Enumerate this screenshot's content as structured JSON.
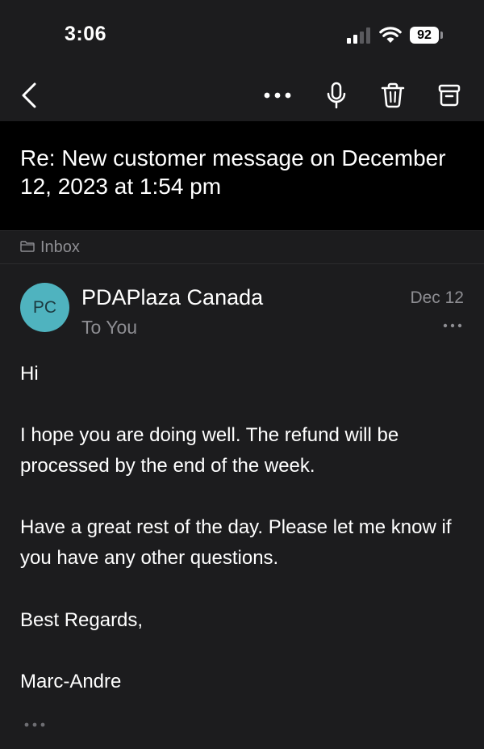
{
  "status_bar": {
    "time": "3:06",
    "battery": "92"
  },
  "toolbar": {
    "back_icon": "chevron-left-icon",
    "more_icon": "more-horizontal-icon",
    "mic_icon": "microphone-icon",
    "trash_icon": "trash-icon",
    "archive_icon": "archive-icon"
  },
  "subject": "Re: New customer message on December 12, 2023 at 1:54 pm",
  "folder": {
    "icon": "folder-icon",
    "label": "Inbox"
  },
  "message": {
    "avatar_initials": "PC",
    "avatar_color": "#4fb3bf",
    "sender": "PDAPlaza Canada",
    "recipient": "To You",
    "date": "Dec 12",
    "body": {
      "greeting": "Hi",
      "paragraph1": "I hope you are doing well. The refund will be processed by the end of the week.",
      "paragraph2": "Have a great rest of the day. Please let me know if you have any other questions.",
      "closing": "Best Regards,",
      "signature": "Marc-Andre"
    }
  },
  "colors": {
    "background": "#1c1c1e",
    "subject_background": "#000000",
    "secondary_text": "#8e8e93"
  }
}
